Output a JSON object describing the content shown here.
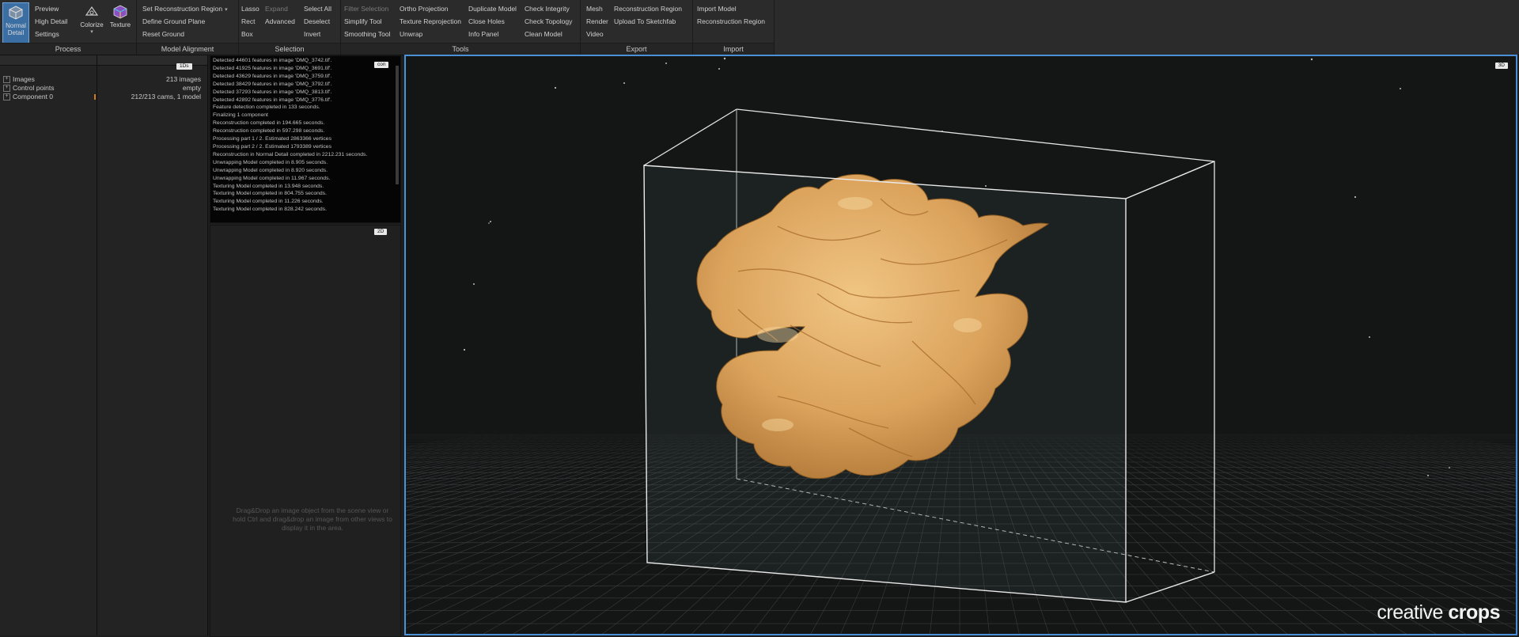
{
  "ribbon": {
    "process": {
      "label": "Process",
      "normal_detail": "Normal\nDetail",
      "preview": "Preview",
      "high_detail": "High Detail",
      "settings": "Settings",
      "colorize": "Colorize",
      "texture": "Texture"
    },
    "model_alignment": {
      "label": "Model Alignment",
      "set_region": "Set Reconstruction Region",
      "define_ground": "Define Ground Plane",
      "reset_ground": "Reset Ground"
    },
    "selection": {
      "label": "Selection",
      "lasso": "Lasso",
      "expand": "Expand",
      "rect": "Rect",
      "advanced": "Advanced",
      "box": "Box",
      "select_all": "Select All",
      "deselect": "Deselect",
      "invert": "Invert"
    },
    "tools": {
      "label": "Tools",
      "filter_selection": "Filter Selection",
      "simplify_tool": "Simplify Tool",
      "smoothing_tool": "Smoothing Tool",
      "ortho_projection": "Ortho Projection",
      "texture_reprojection": "Texture Reprojection",
      "unwrap": "Unwrap",
      "duplicate_model": "Duplicate Model",
      "close_holes": "Close Holes",
      "info_panel": "Info Panel",
      "check_integrity": "Check Integrity",
      "check_topology": "Check Topology",
      "clean_model": "Clean Model"
    },
    "export": {
      "label": "Export",
      "mesh": "Mesh",
      "render": "Render",
      "video": "Video",
      "reconstruction_region": "Reconstruction Region",
      "upload_sketchfab": "Upload To Sketchfab"
    },
    "import": {
      "label": "Import",
      "import_model": "Import Model",
      "reconstruction_region": "Reconstruction Region"
    }
  },
  "project_tree": {
    "view_tag": "1Ds",
    "items": [
      {
        "label": "Images",
        "value": "213 images"
      },
      {
        "label": "Control points",
        "value": "empty"
      },
      {
        "label": "Component 0",
        "value": "212/213 cams, 1 model"
      }
    ]
  },
  "console": {
    "tag": "con",
    "lines": [
      "Detected 44601 features in image 'DMQ_3742.tif'.",
      "Detected 41925 features in image 'DMQ_3691.tif'.",
      "Detected 43629 features in image 'DMQ_3759.tif'.",
      "Detected 38429 features in image 'DMQ_3792.tif'.",
      "Detected 37293 features in image 'DMQ_3813.tif'.",
      "Detected 42892 features in image 'DMQ_3776.tif'.",
      "Feature detection completed in 133 seconds.",
      "Finalizing 1 component",
      "Reconstruction completed in 194.665 seconds.",
      "Reconstruction completed in 597.298 seconds.",
      "Processing part 1 / 2. Estimated 2863366 vertices",
      "Processing part 2 / 2. Estimated 1793389 vertices",
      "Reconstruction in Normal Detail completed in 2212.231 seconds.",
      "Unwrapping Model completed in 8.905 seconds.",
      "Unwrapping Model completed in 8.920 seconds.",
      "Unwrapping Model completed in 11.967 seconds.",
      "Texturing Model completed in 13.948 seconds.",
      "Texturing Model completed in 804.755 seconds.",
      "Texturing Model completed in 11.226 seconds.",
      "Texturing Model completed in 828.242 seconds."
    ]
  },
  "view2d": {
    "tag": "2D",
    "hint": "Drag&Drop an image object from the scene view or hold Ctrl and drag&drop an image from other views to display it in the area."
  },
  "view3d": {
    "tag": "3D",
    "watermark_light": "creative ",
    "watermark_bold": "crops"
  },
  "colors": {
    "accent": "#4b8fd6",
    "active_button": "#3b6ea3",
    "walnut": "#d9a35e"
  }
}
